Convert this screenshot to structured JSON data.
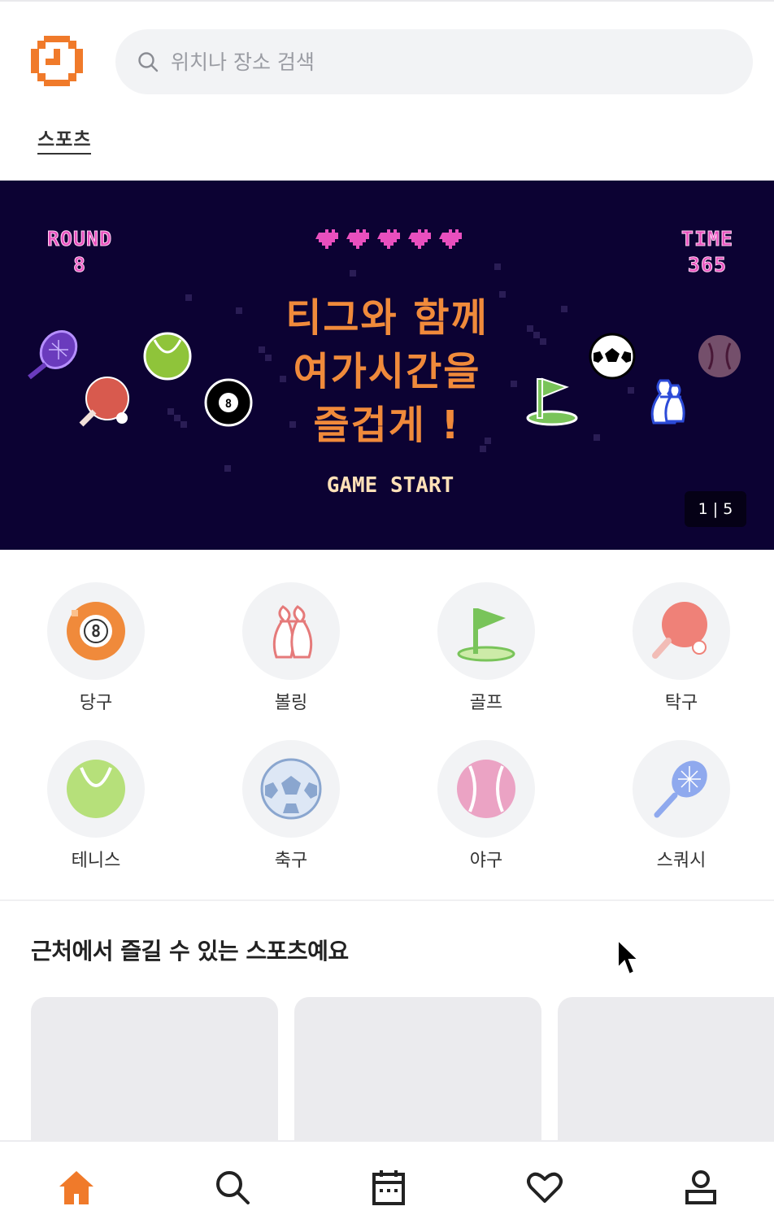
{
  "header": {
    "search_placeholder": "위치나 장소 검색",
    "category_tab": "스포츠"
  },
  "banner": {
    "round_label": "ROUND",
    "round_value": "8",
    "time_label": "TIME",
    "time_value": "365",
    "lives": 5,
    "title_line1": "티그와 함께",
    "title_line2": "여가시간을",
    "title_line3": "즐겁게 !",
    "cta": "GAME START",
    "pager": "1 | 5"
  },
  "categories": [
    {
      "label": "당구",
      "icon": "billiard-ball-icon"
    },
    {
      "label": "볼링",
      "icon": "bowling-pins-icon"
    },
    {
      "label": "골프",
      "icon": "golf-flag-icon"
    },
    {
      "label": "탁구",
      "icon": "ping-pong-paddle-icon"
    },
    {
      "label": "테니스",
      "icon": "tennis-ball-icon"
    },
    {
      "label": "축구",
      "icon": "soccer-ball-icon"
    },
    {
      "label": "야구",
      "icon": "baseball-icon"
    },
    {
      "label": "스쿼시",
      "icon": "squash-racket-icon"
    }
  ],
  "nearby": {
    "title": "근처에서 즐길 수 있는 스포츠예요"
  },
  "bottom_nav": [
    {
      "name": "home",
      "icon": "home-icon",
      "active": true
    },
    {
      "name": "search",
      "icon": "search-icon",
      "active": false
    },
    {
      "name": "calendar",
      "icon": "calendar-icon",
      "active": false
    },
    {
      "name": "likes",
      "icon": "heart-icon",
      "active": false
    },
    {
      "name": "profile",
      "icon": "user-icon",
      "active": false
    }
  ],
  "colors": {
    "brand": "#f07a2a",
    "banner_bg": "#0c0233",
    "banner_title": "#f08a3b",
    "hud_pink": "#e94fbe",
    "chip_bg": "#f2f3f5"
  }
}
